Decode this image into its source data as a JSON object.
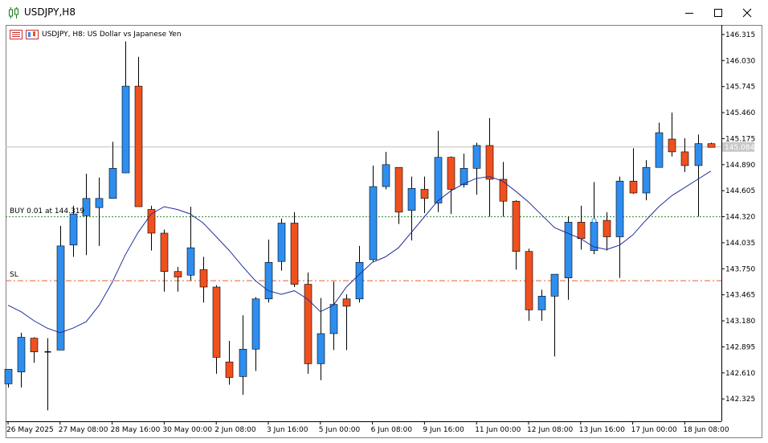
{
  "window": {
    "title": "USDJPY,H8",
    "buttons": {
      "minimize": "minimize-icon",
      "maximize": "maximize-icon",
      "close": "close-icon"
    }
  },
  "chart_header": {
    "text": "USDJPY, H8:  US Dollar vs Japanese Yen"
  },
  "trade": {
    "buy_label": "BUY 0.01 at 144.319",
    "buy_price": 144.319,
    "sl_label": "SL",
    "sl_price": 143.62
  },
  "colors": {
    "bull": "#2e8ef0",
    "bear": "#f0501e",
    "wick": "#000000",
    "ma": "#1f2f9c",
    "buy_line": "#2a8a2a",
    "sl_line": "#e0602a",
    "bid_line": "#c0c0c0",
    "frame": "#7f7f7f"
  },
  "chart_data": {
    "type": "candlestick",
    "symbol": "USDJPY",
    "timeframe": "H8",
    "ylim": [
      142.08,
      146.42
    ],
    "current_price": 145.084,
    "price_ticks": [
      "146.315",
      "146.030",
      "145.745",
      "145.460",
      "145.175",
      "144.890",
      "144.605",
      "144.320",
      "144.035",
      "143.750",
      "143.465",
      "143.180",
      "142.895",
      "142.610",
      "142.325"
    ],
    "current_price_label": "145.084",
    "time_labels": [
      {
        "label": "26 May 2025",
        "index": 0
      },
      {
        "label": "27 May 08:00",
        "index": 4
      },
      {
        "label": "28 May 16:00",
        "index": 8
      },
      {
        "label": "30 May 00:00",
        "index": 12
      },
      {
        "label": "2 Jun 08:00",
        "index": 16
      },
      {
        "label": "3 Jun 16:00",
        "index": 20
      },
      {
        "label": "5 Jun 00:00",
        "index": 24
      },
      {
        "label": "6 Jun 08:00",
        "index": 28
      },
      {
        "label": "9 Jun 16:00",
        "index": 32
      },
      {
        "label": "11 Jun 00:00",
        "index": 36
      },
      {
        "label": "12 Jun 08:00",
        "index": 40
      },
      {
        "label": "13 Jun 16:00",
        "index": 44
      },
      {
        "label": "17 Jun 00:00",
        "index": 48
      },
      {
        "label": "18 Jun 08:00",
        "index": 52
      }
    ],
    "candles": [
      {
        "o": 142.49,
        "h": 142.6,
        "l": 142.45,
        "c": 142.65
      },
      {
        "o": 142.62,
        "h": 143.05,
        "l": 142.45,
        "c": 143.0
      },
      {
        "o": 142.99,
        "h": 143.0,
        "l": 142.72,
        "c": 142.84
      },
      {
        "o": 142.84,
        "h": 142.99,
        "l": 142.2,
        "c": 142.84
      },
      {
        "o": 142.86,
        "h": 144.22,
        "l": 142.86,
        "c": 144.0
      },
      {
        "o": 144.01,
        "h": 144.44,
        "l": 143.88,
        "c": 144.35
      },
      {
        "o": 144.33,
        "h": 144.79,
        "l": 143.9,
        "c": 144.52
      },
      {
        "o": 144.42,
        "h": 144.75,
        "l": 144.0,
        "c": 144.52
      },
      {
        "o": 144.52,
        "h": 145.14,
        "l": 144.52,
        "c": 144.85
      },
      {
        "o": 144.8,
        "h": 146.24,
        "l": 144.8,
        "c": 145.75
      },
      {
        "o": 145.75,
        "h": 146.07,
        "l": 144.43,
        "c": 144.43
      },
      {
        "o": 144.4,
        "h": 144.44,
        "l": 143.95,
        "c": 144.14
      },
      {
        "o": 144.14,
        "h": 144.18,
        "l": 143.5,
        "c": 143.72
      },
      {
        "o": 143.72,
        "h": 143.77,
        "l": 143.5,
        "c": 143.66
      },
      {
        "o": 143.68,
        "h": 144.43,
        "l": 143.62,
        "c": 143.98
      },
      {
        "o": 143.74,
        "h": 143.88,
        "l": 143.38,
        "c": 143.55
      },
      {
        "o": 143.55,
        "h": 143.57,
        "l": 142.6,
        "c": 142.78
      },
      {
        "o": 142.73,
        "h": 142.96,
        "l": 142.48,
        "c": 142.56
      },
      {
        "o": 142.57,
        "h": 143.24,
        "l": 142.37,
        "c": 142.87
      },
      {
        "o": 142.87,
        "h": 143.44,
        "l": 142.63,
        "c": 143.42
      },
      {
        "o": 143.42,
        "h": 144.07,
        "l": 143.38,
        "c": 143.82
      },
      {
        "o": 143.83,
        "h": 144.3,
        "l": 143.73,
        "c": 144.25
      },
      {
        "o": 144.25,
        "h": 144.37,
        "l": 143.55,
        "c": 143.58
      },
      {
        "o": 143.58,
        "h": 143.71,
        "l": 142.6,
        "c": 142.71
      },
      {
        "o": 142.71,
        "h": 143.43,
        "l": 142.53,
        "c": 143.04
      },
      {
        "o": 143.04,
        "h": 143.61,
        "l": 142.86,
        "c": 143.36
      },
      {
        "o": 143.42,
        "h": 143.47,
        "l": 142.86,
        "c": 143.34
      },
      {
        "o": 143.42,
        "h": 144.0,
        "l": 143.38,
        "c": 143.82
      },
      {
        "o": 143.85,
        "h": 144.88,
        "l": 143.83,
        "c": 144.65
      },
      {
        "o": 144.65,
        "h": 145.03,
        "l": 144.62,
        "c": 144.89
      },
      {
        "o": 144.86,
        "h": 144.86,
        "l": 144.24,
        "c": 144.37
      },
      {
        "o": 144.39,
        "h": 144.76,
        "l": 144.06,
        "c": 144.63
      },
      {
        "o": 144.62,
        "h": 144.76,
        "l": 144.36,
        "c": 144.52
      },
      {
        "o": 144.47,
        "h": 145.26,
        "l": 144.37,
        "c": 144.97
      },
      {
        "o": 144.97,
        "h": 144.98,
        "l": 144.35,
        "c": 144.62
      },
      {
        "o": 144.67,
        "h": 145.01,
        "l": 144.64,
        "c": 144.85
      },
      {
        "o": 144.85,
        "h": 145.13,
        "l": 144.56,
        "c": 145.1
      },
      {
        "o": 145.1,
        "h": 145.4,
        "l": 144.32,
        "c": 144.73
      },
      {
        "o": 144.73,
        "h": 144.92,
        "l": 144.32,
        "c": 144.49
      },
      {
        "o": 144.49,
        "h": 144.5,
        "l": 143.74,
        "c": 143.94
      },
      {
        "o": 143.94,
        "h": 143.97,
        "l": 143.18,
        "c": 143.3
      },
      {
        "o": 143.3,
        "h": 143.52,
        "l": 143.18,
        "c": 143.45
      },
      {
        "o": 143.45,
        "h": 143.68,
        "l": 142.79,
        "c": 143.69
      },
      {
        "o": 143.65,
        "h": 144.32,
        "l": 143.41,
        "c": 144.26
      },
      {
        "o": 144.26,
        "h": 144.44,
        "l": 143.96,
        "c": 144.08
      },
      {
        "o": 143.95,
        "h": 144.7,
        "l": 143.91,
        "c": 144.26
      },
      {
        "o": 144.28,
        "h": 144.37,
        "l": 143.95,
        "c": 144.1
      },
      {
        "o": 144.1,
        "h": 144.76,
        "l": 143.65,
        "c": 144.71
      },
      {
        "o": 144.71,
        "h": 145.07,
        "l": 144.57,
        "c": 144.58
      },
      {
        "o": 144.58,
        "h": 144.94,
        "l": 144.5,
        "c": 144.86
      },
      {
        "o": 144.86,
        "h": 145.35,
        "l": 144.86,
        "c": 145.24
      },
      {
        "o": 145.17,
        "h": 145.46,
        "l": 144.98,
        "c": 145.03
      },
      {
        "o": 145.03,
        "h": 145.18,
        "l": 144.81,
        "c": 144.88
      },
      {
        "o": 144.88,
        "h": 145.22,
        "l": 144.32,
        "c": 145.12
      },
      {
        "o": 145.12,
        "h": 145.13,
        "l": 145.08,
        "c": 145.08
      }
    ],
    "ma": [
      143.35,
      143.28,
      143.18,
      143.1,
      143.05,
      143.1,
      143.17,
      143.35,
      143.6,
      143.9,
      144.15,
      144.35,
      144.43,
      144.4,
      144.35,
      144.25,
      144.1,
      143.95,
      143.78,
      143.62,
      143.51,
      143.47,
      143.51,
      143.42,
      143.28,
      143.35,
      143.55,
      143.69,
      143.82,
      143.88,
      143.98,
      144.15,
      144.32,
      144.49,
      144.6,
      144.68,
      144.74,
      144.76,
      144.71,
      144.6,
      144.48,
      144.34,
      144.2,
      144.14,
      144.08,
      143.99,
      143.96,
      144.01,
      144.12,
      144.28,
      144.43,
      144.55,
      144.64,
      144.73,
      144.82
    ]
  }
}
